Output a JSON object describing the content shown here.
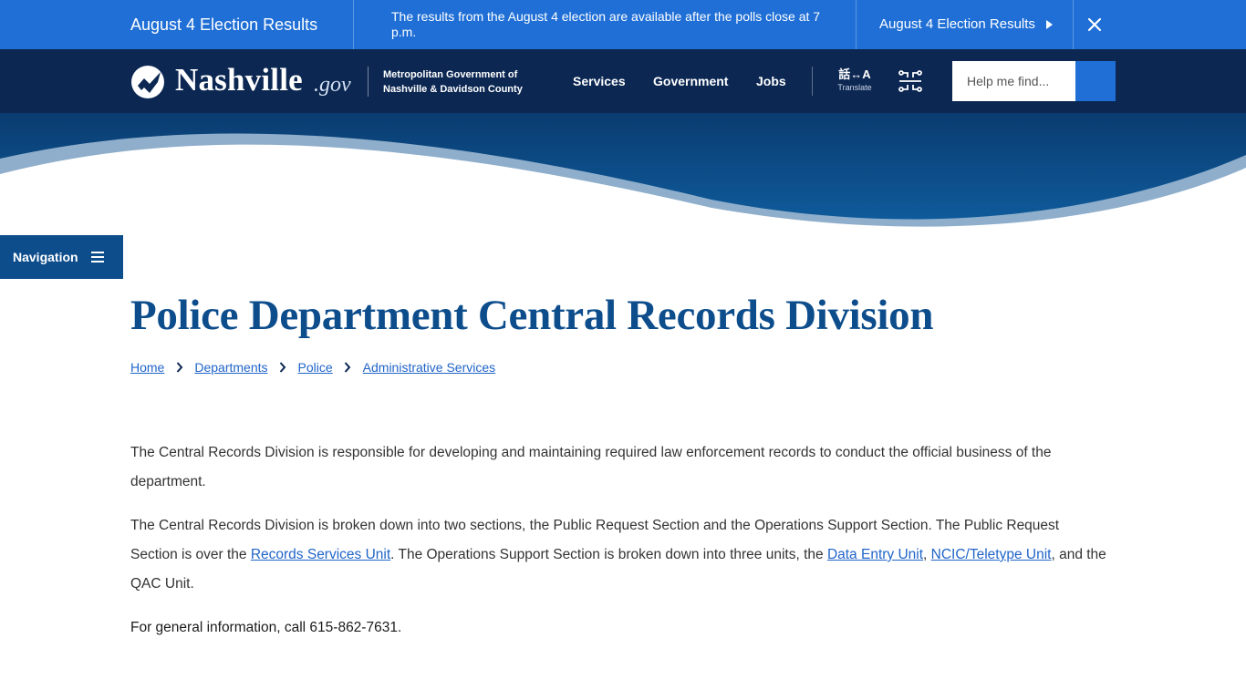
{
  "alert": {
    "title": "August 4 Election Results",
    "message": "The results from the August 4 election are available after the polls close at 7 p.m.",
    "link_label": "August 4 Election Results"
  },
  "header": {
    "logo_word": "Nashville",
    "logo_suffix": ".gov",
    "metro_line1": "Metropolitan Government of",
    "metro_line2": "Nashville & Davidson County",
    "nav": {
      "services": "Services",
      "government": "Government",
      "jobs": "Jobs"
    },
    "translate_glyph": "話↔A",
    "translate_label": "Translate",
    "search_placeholder": "Help me find..."
  },
  "side_nav": {
    "label": "Navigation"
  },
  "page": {
    "title": "Police Department Central Records Division",
    "breadcrumb": [
      "Home",
      "Departments",
      "Police",
      "Administrative Services"
    ],
    "p1": "The Central Records Division is responsible for developing and maintaining required law enforcement records to conduct the official business of the department.",
    "p2_text1": "The Central Records Division is broken down into two sections, the Public Request Section and the Operations Support Section. The Public Request Section is over the ",
    "p2_link1": "Records Services Unit",
    "p2_text2": ". The Operations Support Section is broken down into three units, the ",
    "p2_link2": "Data Entry Unit",
    "p2_text3": ", ",
    "p2_link3": "NCIC/Teletype Unit",
    "p2_text4": ", and the QAC Unit.",
    "contact": "For general information, call 615-862-7631",
    "contact_end": "."
  },
  "colors": {
    "alert_blue": "#1f6fd6",
    "header_navy": "#0b2752",
    "brand_blue": "#0d4d8c",
    "link_blue": "#1f64c8"
  },
  "icons": {
    "close": "close-icon",
    "arrow": "triangle-right-icon",
    "logo": "nashville-logo-icon",
    "alt_nav": "circuit-icon",
    "search": "search-icon",
    "menu": "hamburger-icon",
    "breadcrumb_sep": "chevron-right-icon"
  }
}
